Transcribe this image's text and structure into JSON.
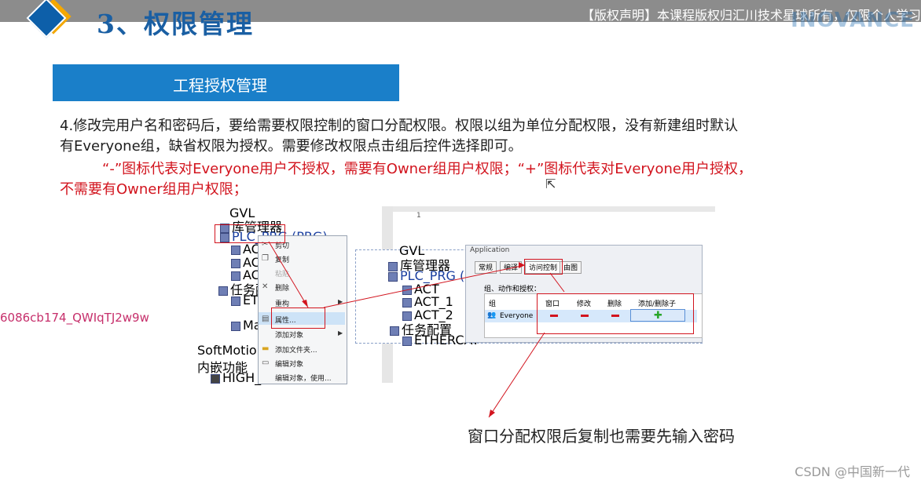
{
  "header": {
    "section_title": "3、权限管理",
    "copyright": "【版权声明】本课程版权归汇川技术星球所有，仅限个人学习",
    "logo": "INOVANCE"
  },
  "subtitle": "工程授权管理",
  "body": {
    "para1_line1": "4.修改完用户名和密码后，要给需要权限控制的窗口分配权限。权限以组为单位分配权限，没有新建组时默认",
    "para1_line2": "有Everyone组，缺省权限为授权。需要修改权限点击组后控件选择即可。",
    "para2_line1": "“-”图标代表对Everyone用户不授权，需要有Owner组用户权限；“+”图标代表对Everyone用户授权，",
    "para2_line2": "不需要有Owner组用户权限；"
  },
  "watermark_id": "6086cb174_QWIqTJ2w9w",
  "caption": "窗口分配权限后复制也需要先输入密码",
  "csdn": "CSDN @中国新一代",
  "screenshot": {
    "tree": [
      "GVL",
      "库管理器",
      "PLC_PRG (PRG)",
      "ACT",
      "ACT_",
      "ACT_",
      "任务配置",
      "ETHE",
      "Main",
      "SoftMotion Gener",
      "内嵌功能",
      "HIGH_SPE"
    ],
    "context_menu": [
      "剪切",
      "复制",
      "粘贴",
      "删除",
      "重构",
      "属性...",
      "添加对象",
      "添加文件夹...",
      "编辑对象",
      "编辑对象，使用..."
    ],
    "tree2": [
      "GVL",
      "库管理器",
      "PLC_PRG (PRG)",
      "ACT",
      "ACT_1",
      "ACT_2",
      "任务配置",
      "ETHERCAT"
    ],
    "dialog_tabs": [
      "常规",
      "编译",
      "访问控制",
      "由图"
    ],
    "dialog_title": "Application",
    "group_label": "组、动作和授权：",
    "columns": [
      "组",
      "窗口",
      "修改",
      "删除",
      "添加/删除子"
    ],
    "row_group": "Everyone",
    "line_number": "1"
  },
  "colors": {
    "accent": "#1a7fc9",
    "red": "#d2141e",
    "title": "#1a5fa3"
  }
}
